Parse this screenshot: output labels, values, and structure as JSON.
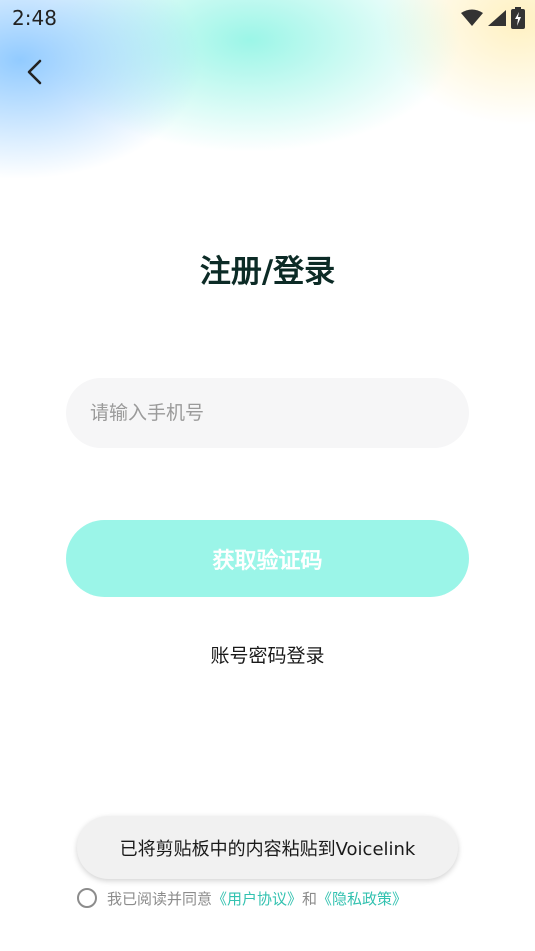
{
  "status_bar": {
    "time": "2:48",
    "icons": [
      "wifi-icon",
      "cell-signal-icon",
      "battery-charging-icon"
    ]
  },
  "nav": {
    "back_icon": "chevron-left-icon"
  },
  "login": {
    "title": "注册/登录",
    "phone_placeholder": "请输入手机号",
    "phone_value": "",
    "get_code_label": "获取验证码",
    "password_login_label": "账号密码登录"
  },
  "toast": {
    "text": "已将剪贴板中的内容粘贴到Voicelink"
  },
  "agreement": {
    "prefix": "我已阅读并同意",
    "user_agreement": "《用户协议》",
    "and": "和",
    "privacy_policy": "《隐私政策》"
  },
  "colors": {
    "accent": "#9bf5e8",
    "link": "#33c2b0",
    "title": "#0c2b26"
  }
}
